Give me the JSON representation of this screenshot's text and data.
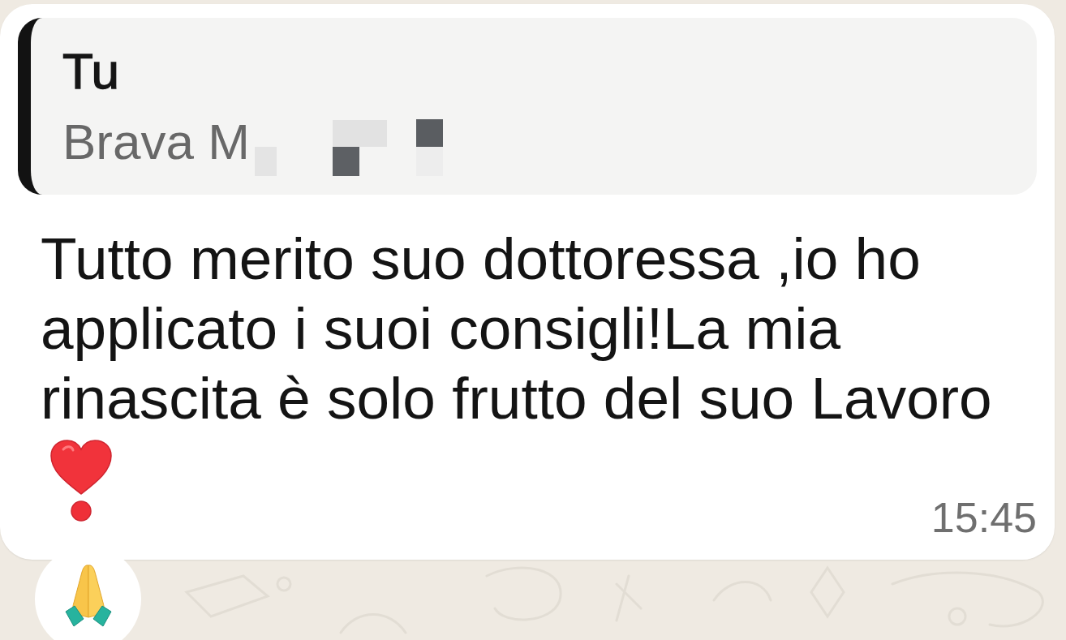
{
  "message": {
    "quote": {
      "author": "Tu",
      "text": "Brava M",
      "redacted": true
    },
    "text": "Tutto merito suo dottoressa ,io ho applicato i suoi consigli!La mia rinascita è solo frutto del suo Lavoro",
    "time": "15:45"
  }
}
